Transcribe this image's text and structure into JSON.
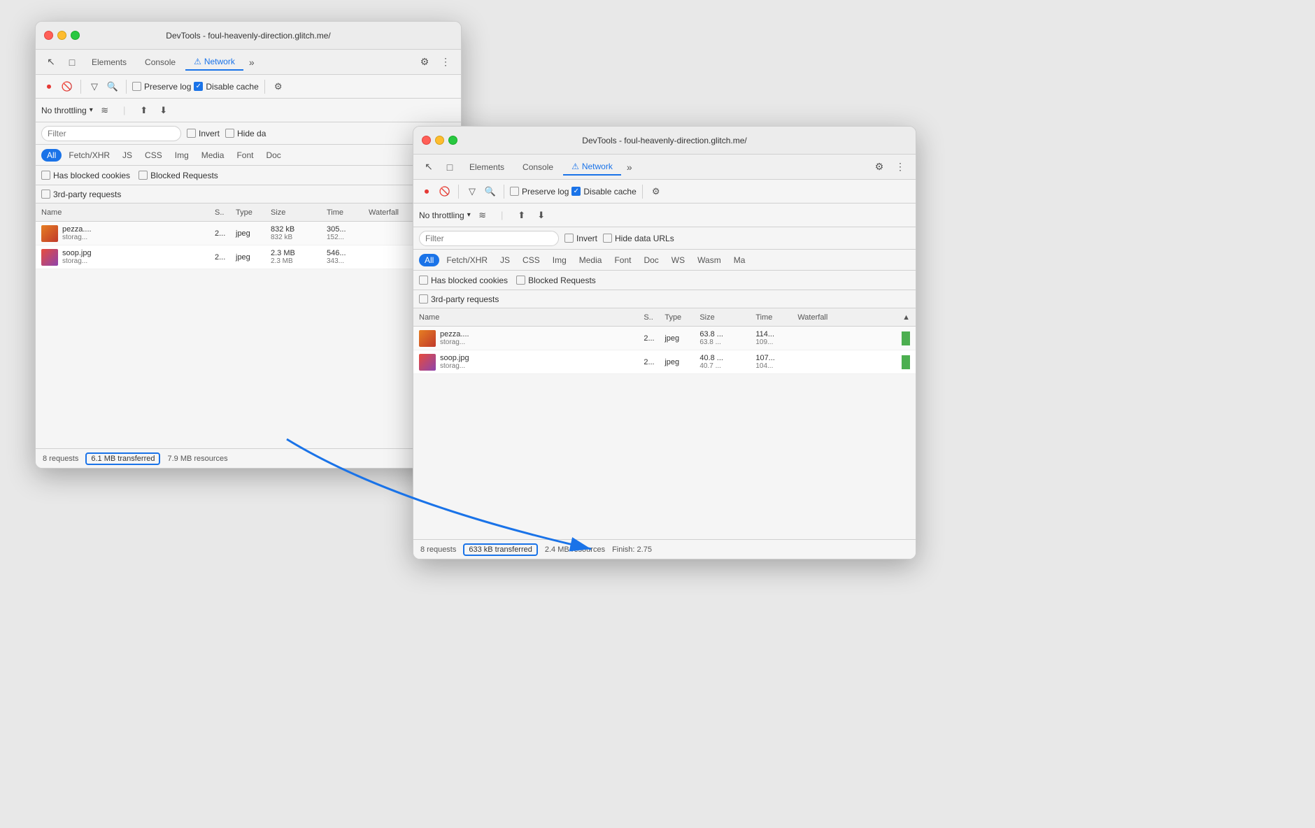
{
  "window_back": {
    "title": "DevTools - foul-heavenly-direction.glitch.me/",
    "tabs": [
      "Elements",
      "Console",
      "Network"
    ],
    "active_tab": "Network",
    "toolbar": {
      "preserve_log": "Preserve log",
      "disable_cache": "Disable cache",
      "no_throttling": "No throttling"
    },
    "filter_label": "Filter",
    "invert_label": "Invert",
    "hide_data_label": "Hide da",
    "type_filters": [
      "All",
      "Fetch/XHR",
      "JS",
      "CSS",
      "Img",
      "Media",
      "Font",
      "Doc"
    ],
    "options": {
      "has_blocked": "Has blocked cookies",
      "blocked_requests": "Blocked Requests",
      "third_party": "3rd-party requests"
    },
    "columns": [
      "Name",
      "S..",
      "Type",
      "Size",
      "Time",
      "Waterfall"
    ],
    "rows": [
      {
        "thumb": "pizza",
        "name": "pezza....",
        "sub": "storag...",
        "s": "2...",
        "type": "jpeg",
        "size": "832 kB",
        "size2": "832 kB",
        "time": "305...",
        "time2": "152..."
      },
      {
        "thumb": "soop",
        "name": "soop.jpg",
        "sub": "storag...",
        "s": "2...",
        "type": "jpeg",
        "size": "2.3 MB",
        "size2": "2.3 MB",
        "time": "546...",
        "time2": "343..."
      }
    ],
    "status": {
      "requests": "8 requests",
      "transferred": "6.1 MB transferred",
      "resources": "7.9 MB resources"
    }
  },
  "window_front": {
    "title": "DevTools - foul-heavenly-direction.glitch.me/",
    "tabs": [
      "Elements",
      "Console",
      "Network"
    ],
    "active_tab": "Network",
    "toolbar": {
      "preserve_log": "Preserve log",
      "disable_cache": "Disable cache",
      "no_throttling": "No throttling"
    },
    "filter_label": "Filter",
    "invert_label": "Invert",
    "hide_data_label": "Hide data URLs",
    "type_filters": [
      "All",
      "Fetch/XHR",
      "JS",
      "CSS",
      "Img",
      "Media",
      "Font",
      "Doc",
      "WS",
      "Wasm",
      "Ma"
    ],
    "options": {
      "has_blocked": "Has blocked cookies",
      "blocked_requests": "Blocked Requests",
      "third_party": "3rd-party requests"
    },
    "columns": [
      "Name",
      "S..",
      "Type",
      "Size",
      "Time",
      "Waterfall"
    ],
    "rows": [
      {
        "thumb": "pizza",
        "name": "pezza....",
        "sub": "storag...",
        "s": "2...",
        "type": "jpeg",
        "size": "63.8 ...",
        "size2": "63.8 ...",
        "time": "114...",
        "time2": "109..."
      },
      {
        "thumb": "soop",
        "name": "soop.jpg",
        "sub": "storag...",
        "s": "2...",
        "type": "jpeg",
        "size": "40.8 ...",
        "size2": "40.7 ...",
        "time": "107...",
        "time2": "104..."
      }
    ],
    "status": {
      "requests": "8 requests",
      "transferred": "633 kB transferred",
      "resources": "2.4 MB resources",
      "finish": "Finish: 2.75"
    }
  },
  "icons": {
    "record": "⏺",
    "stop": "🚫",
    "filter": "▽",
    "search": "🔍",
    "upload": "⬆",
    "download": "⬇",
    "wifi": "≋",
    "gear": "⚙",
    "more": "⋮",
    "chevron": "»",
    "cursor": "↖",
    "inspect": "□",
    "check": "✓",
    "warning": "⚠"
  }
}
